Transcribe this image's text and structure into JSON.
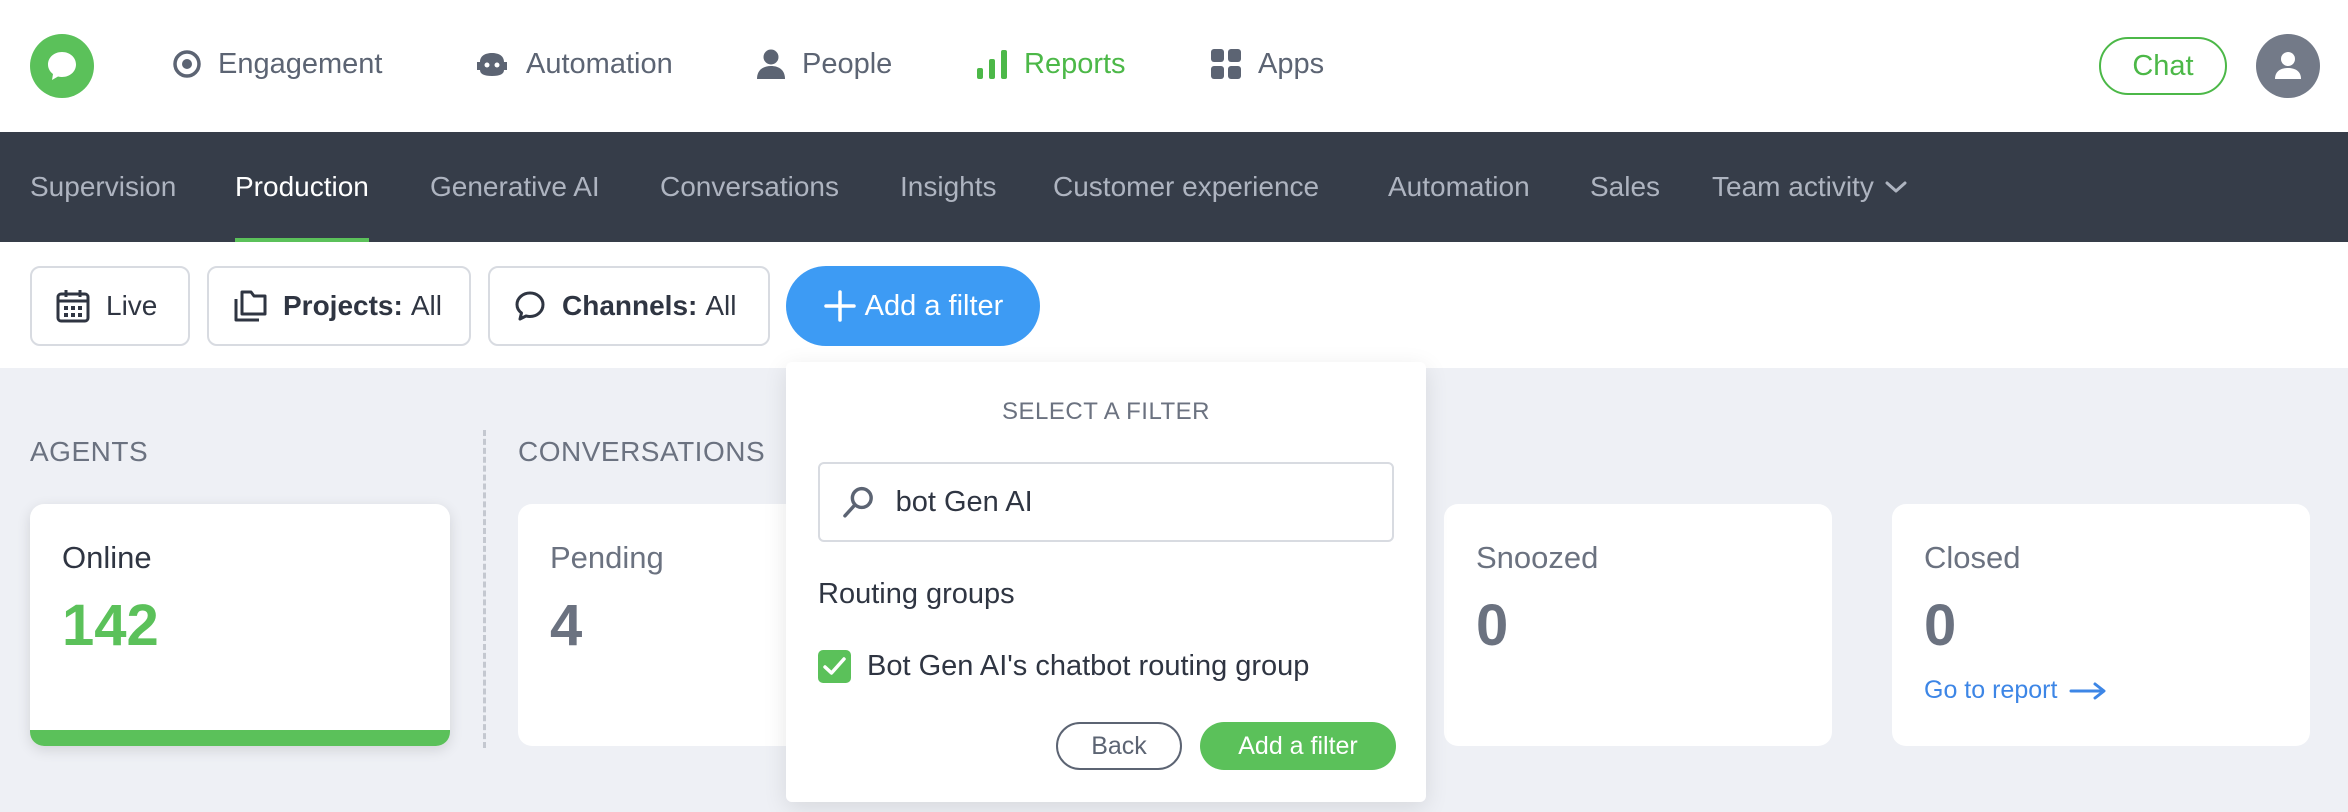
{
  "topnav": {
    "items": [
      {
        "label": "Engagement",
        "icon": "target-icon"
      },
      {
        "label": "Automation",
        "icon": "robot-icon"
      },
      {
        "label": "People",
        "icon": "person-icon"
      },
      {
        "label": "Reports",
        "icon": "bar-chart-icon"
      },
      {
        "label": "Apps",
        "icon": "grid-icon"
      }
    ],
    "active": "Reports",
    "chat_label": "Chat"
  },
  "subnav": {
    "items": [
      "Supervision",
      "Production",
      "Generative AI",
      "Conversations",
      "Insights",
      "Customer experience",
      "Automation",
      "Sales",
      "Team activity"
    ],
    "active": "Production"
  },
  "filters": {
    "live_label": "Live",
    "projects_key": "Projects:",
    "projects_value": "All",
    "channels_key": "Channels:",
    "channels_value": "All",
    "add_filter_label": "Add a filter"
  },
  "sections": {
    "agents": "AGENTS",
    "conversations": "CONVERSATIONS"
  },
  "cards": {
    "online": {
      "label": "Online",
      "value": "142"
    },
    "pending": {
      "label": "Pending",
      "value": "4"
    },
    "snoozed": {
      "label": "Snoozed",
      "value": "0"
    },
    "closed": {
      "label": "Closed",
      "value": "0",
      "link": "Go to report"
    }
  },
  "popup": {
    "title": "SELECT A FILTER",
    "search_value": "bot Gen AI",
    "group_title": "Routing groups",
    "option_label": "Bot Gen AI's chatbot routing group",
    "option_checked": true,
    "back_label": "Back",
    "apply_label": "Add a filter"
  },
  "colors": {
    "accent_green": "#5bc15a",
    "accent_blue": "#3d9bf4",
    "subnav_bg": "#363d49"
  }
}
